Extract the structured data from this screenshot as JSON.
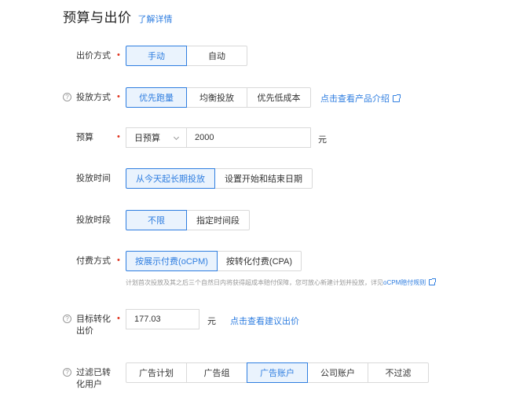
{
  "header": {
    "title": "预算与出价",
    "learn_more": "了解详情"
  },
  "bid_method": {
    "label": "出价方式",
    "required": "•",
    "options": [
      "手动",
      "自动"
    ],
    "selected": "手动"
  },
  "delivery_method": {
    "label": "投放方式",
    "required": "•",
    "options": [
      "优先跑量",
      "均衡投放",
      "优先低成本"
    ],
    "selected": "优先跑量",
    "link": "点击查看产品介绍"
  },
  "budget": {
    "label": "预算",
    "required": "•",
    "type_value": "日预算",
    "amount": "2000",
    "unit": "元"
  },
  "delivery_time": {
    "label": "投放时间",
    "options": [
      "从今天起长期投放",
      "设置开始和结束日期"
    ],
    "selected": "从今天起长期投放"
  },
  "time_slot": {
    "label": "投放时段",
    "options": [
      "不限",
      "指定时间段"
    ],
    "selected": "不限"
  },
  "pay_method": {
    "label": "付费方式",
    "required": "•",
    "options": [
      "按展示付费(oCPM)",
      "按转化付费(CPA)"
    ],
    "selected": "按展示付费(oCPM)",
    "note": "计划首次投放及其之后三个自然日内将获得超成本赔付保障，您可放心新建计划并投放，详见",
    "note_link": "oCPM赔付规则"
  },
  "target_bid": {
    "label_line1": "目标转化",
    "label_line2": "出价",
    "required": "•",
    "value": "177.03",
    "unit": "元",
    "link": "点击查看建议出价"
  },
  "filter_converted": {
    "label_line1": "过滤已转",
    "label_line2": "化用户",
    "options": [
      "广告计划",
      "广告组",
      "广告账户",
      "公司账户",
      "不过滤"
    ],
    "selected": "广告账户"
  },
  "icons": {
    "help": "question-circle-icon",
    "external": "external-link-icon",
    "dropdown": "chevron-down-icon"
  },
  "colors": {
    "accent": "#2f7ee0",
    "required": "#e0341f",
    "active_bg": "#eaf3fd"
  }
}
